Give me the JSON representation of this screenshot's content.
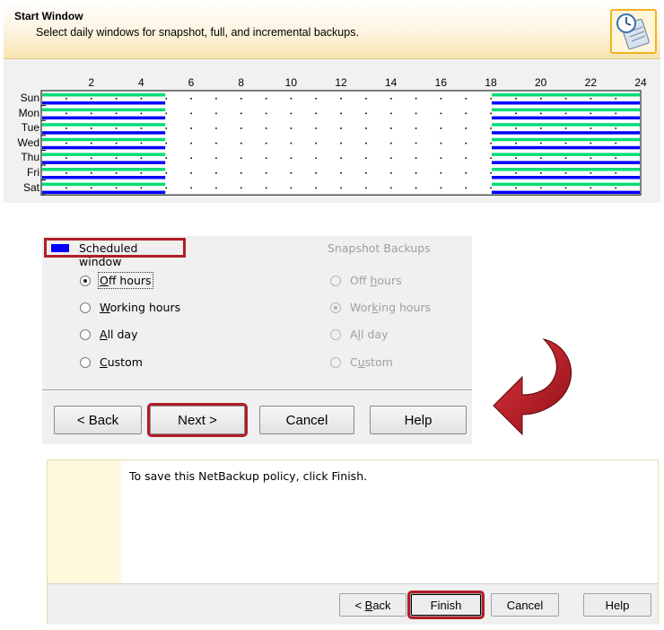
{
  "header": {
    "title": "Start Window",
    "subtitle": "Select daily windows for snapshot, full, and incremental backups.",
    "icon": "schedule-clock-icon"
  },
  "grid": {
    "hours": [
      "2",
      "4",
      "6",
      "8",
      "10",
      "12",
      "14",
      "16",
      "18",
      "20",
      "22",
      "24"
    ],
    "days": [
      "Sun",
      "Mon",
      "Tue",
      "Wed",
      "Thu",
      "Fri",
      "Sat"
    ],
    "scheduled_hours": [
      [
        0,
        5
      ],
      [
        18,
        24
      ]
    ],
    "colors": {
      "scheduled": "#0000ff",
      "selected": "#00dd77",
      "background": "#ffffff"
    }
  },
  "legend": {
    "label": "Scheduled window"
  },
  "schedule_options": {
    "items": [
      {
        "label": "Off hours",
        "underline": "O",
        "rest": "ff hours",
        "checked": true
      },
      {
        "label": "Working hours",
        "underline": "W",
        "rest": "orking hours",
        "checked": false
      },
      {
        "label": "All day",
        "underline": "A",
        "rest": "ll day",
        "checked": false
      },
      {
        "label": "Custom",
        "underline": "C",
        "rest": "ustom",
        "checked": false
      }
    ]
  },
  "snapshot_options": {
    "title": "Snapshot Backups",
    "items": [
      {
        "pre": "Off ",
        "underline": "h",
        "rest": "ours",
        "checked": false
      },
      {
        "pre": "Wor",
        "underline": "k",
        "rest": "ing hours",
        "checked": true
      },
      {
        "pre": "A",
        "underline": "l",
        "rest": "l day",
        "checked": false
      },
      {
        "pre": "C",
        "underline": "u",
        "rest": "stom",
        "checked": false
      }
    ]
  },
  "wizard_buttons": {
    "back": "< Back",
    "next": "Next >",
    "cancel": "Cancel",
    "help": "Help"
  },
  "finish": {
    "message": "To save this NetBackup policy, click Finish.",
    "back": "< Back",
    "finish": "Finish",
    "cancel": "Cancel",
    "help": "Help"
  },
  "annotation_color": "#b01e27"
}
